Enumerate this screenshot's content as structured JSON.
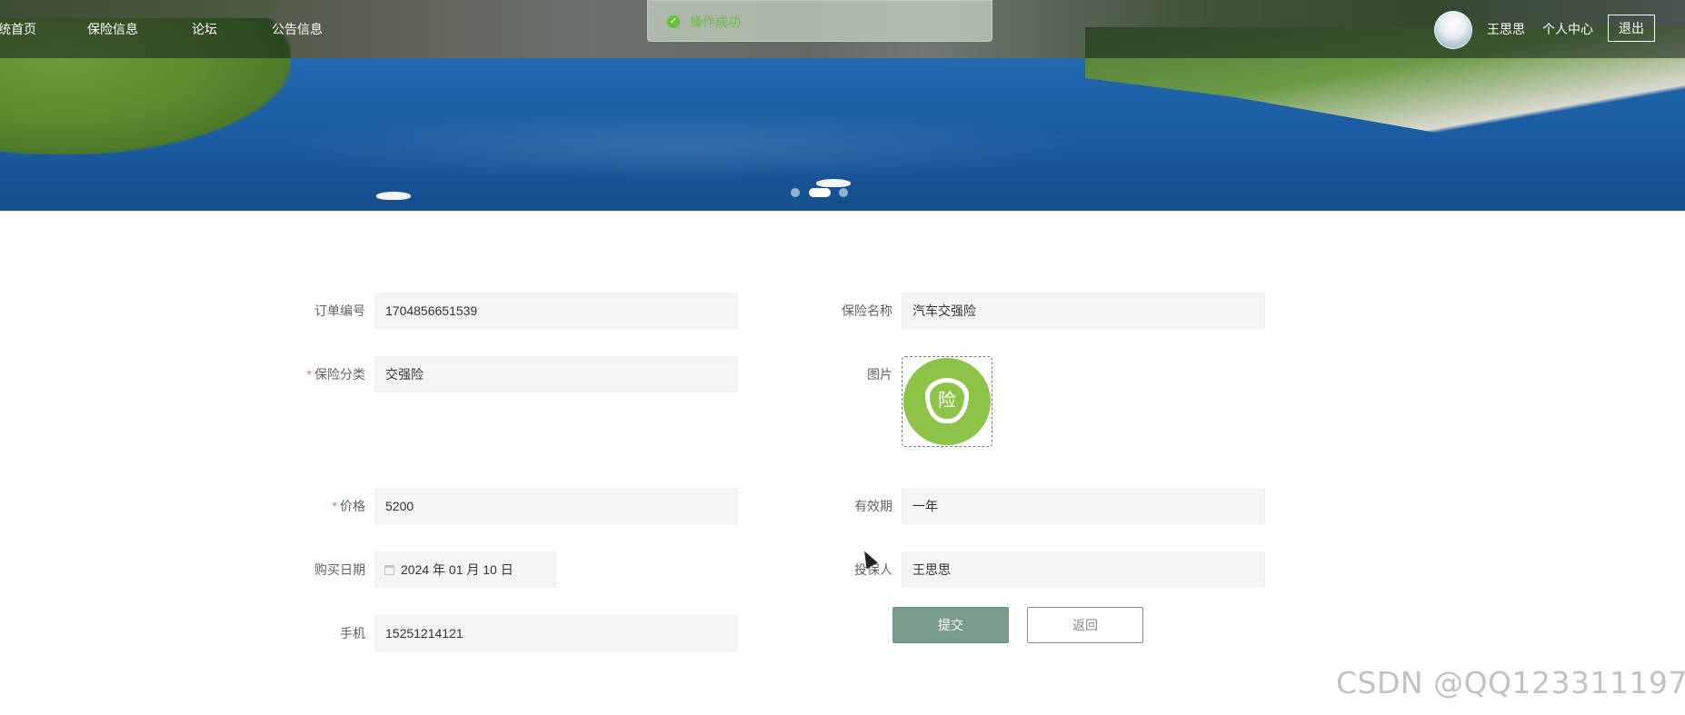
{
  "nav": {
    "home": "统首页",
    "insurance": "保险信息",
    "forum": "论坛",
    "notice": "公告信息"
  },
  "user": {
    "name": "王思思",
    "center": "个人中心",
    "logout": "退出"
  },
  "toast": {
    "message": "操作成功"
  },
  "form": {
    "order_no": {
      "label": "订单编号",
      "value": "1704856651539"
    },
    "insurance_name": {
      "label": "保险名称",
      "value": "汽车交强险"
    },
    "category": {
      "label": "保险分类",
      "value": "交强险"
    },
    "image": {
      "label": "图片",
      "glyph": "险"
    },
    "price": {
      "label": "价格",
      "value": "5200"
    },
    "validity": {
      "label": "有效期",
      "value": "一年"
    },
    "purchase_date": {
      "label": "购买日期",
      "value": "2024 年 01 月 10 日"
    },
    "insured": {
      "label": "投保人",
      "value": "王思思"
    },
    "phone": {
      "label": "手机",
      "value": "15251214121"
    },
    "required_mark": "*",
    "submit": "提交",
    "back": "返回"
  },
  "watermark": "CSDN @QQ123311197",
  "colors": {
    "accent": "#7a9c8c",
    "success": "#67c23a",
    "required": "#f56c6c",
    "insurance_icon": "#8dc447"
  }
}
